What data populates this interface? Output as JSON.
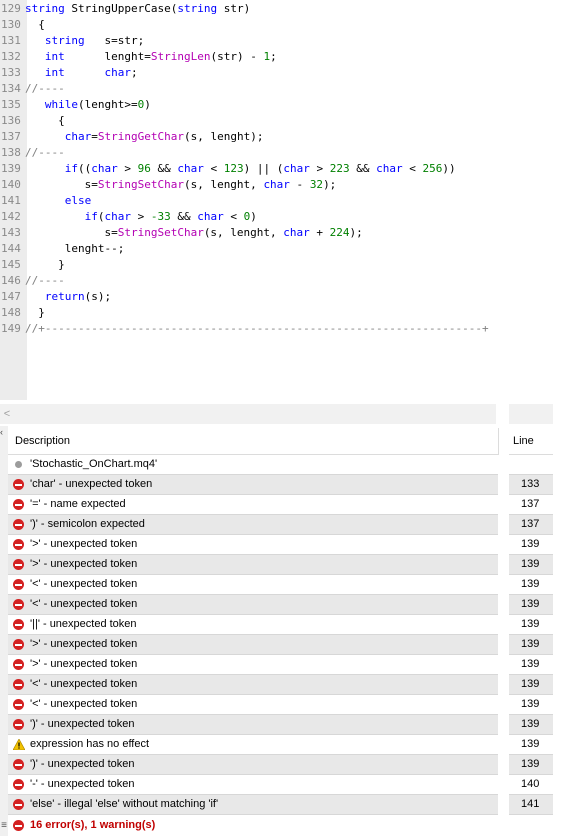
{
  "editor": {
    "lines": [
      {
        "no": "129",
        "html": "<span class=\"kw\">string</span> StringUpperCase(<span class=\"kw\">string</span> str)"
      },
      {
        "no": "130",
        "html": "  {"
      },
      {
        "no": "131",
        "html": "   <span class=\"kw\">string</span>   s=str;"
      },
      {
        "no": "132",
        "html": "   <span class=\"kw\">int</span>      lenght=<span class=\"fn\">StringLen</span>(str) - <span class=\"num\">1</span>;"
      },
      {
        "no": "133",
        "html": "   <span class=\"kw\">int</span>      <span class=\"kw\">char</span>;"
      },
      {
        "no": "134",
        "html": "<span class=\"cm\">//----</span>"
      },
      {
        "no": "135",
        "html": "   <span class=\"kw\">while</span>(lenght>=<span class=\"num\">0</span>)"
      },
      {
        "no": "136",
        "html": "     {"
      },
      {
        "no": "137",
        "html": "      <span class=\"kw\">char</span>=<span class=\"fn\">StringGetChar</span>(s, lenght);"
      },
      {
        "no": "138",
        "html": "<span class=\"cm\">//----</span>"
      },
      {
        "no": "139",
        "html": "      <span class=\"kw\">if</span>((<span class=\"kw\">char</span> > <span class=\"num\">96</span> && <span class=\"kw\">char</span> < <span class=\"num\">123</span>) || (<span class=\"kw\">char</span> > <span class=\"num\">223</span> && <span class=\"kw\">char</span> < <span class=\"num\">256</span>))"
      },
      {
        "no": "140",
        "html": "         s=<span class=\"fn\">StringSetChar</span>(s, lenght, <span class=\"kw\">char</span> - <span class=\"num\">32</span>);"
      },
      {
        "no": "141",
        "html": "      <span class=\"kw\">else</span>"
      },
      {
        "no": "142",
        "html": "         <span class=\"kw\">if</span>(<span class=\"kw\">char</span> > <span class=\"num\">-33</span> && <span class=\"kw\">char</span> < <span class=\"num\">0</span>)"
      },
      {
        "no": "143",
        "html": "            s=<span class=\"fn\">StringSetChar</span>(s, lenght, <span class=\"kw\">char</span> + <span class=\"num\">224</span>);"
      },
      {
        "no": "144",
        "html": "      lenght--;"
      },
      {
        "no": "145",
        "html": "     }"
      },
      {
        "no": "146",
        "html": "<span class=\"cm\">//----</span>"
      },
      {
        "no": "147",
        "html": "   <span class=\"kw\">return</span>(s);"
      },
      {
        "no": "148",
        "html": "  }"
      },
      {
        "no": "149",
        "html": "<span class=\"cm\">//+------------------------------------------------------------------+</span>"
      }
    ]
  },
  "scroll_left_glyph": "<",
  "panel": {
    "header_description": "Description",
    "header_line": "Line",
    "rows": [
      {
        "icon": "file",
        "text": "'Stochastic_OnChart.mq4'",
        "line": ""
      },
      {
        "icon": "error",
        "text": "'char' - unexpected token",
        "line": "133"
      },
      {
        "icon": "error",
        "text": "'=' - name expected",
        "line": "137"
      },
      {
        "icon": "error",
        "text": "')' - semicolon expected",
        "line": "137"
      },
      {
        "icon": "error",
        "text": "'>' - unexpected token",
        "line": "139"
      },
      {
        "icon": "error",
        "text": "'>' - unexpected token",
        "line": "139"
      },
      {
        "icon": "error",
        "text": "'<' - unexpected token",
        "line": "139"
      },
      {
        "icon": "error",
        "text": "'<' - unexpected token",
        "line": "139"
      },
      {
        "icon": "error",
        "text": "'||' - unexpected token",
        "line": "139"
      },
      {
        "icon": "error",
        "text": "'>' - unexpected token",
        "line": "139"
      },
      {
        "icon": "error",
        "text": "'>' - unexpected token",
        "line": "139"
      },
      {
        "icon": "error",
        "text": "'<' - unexpected token",
        "line": "139"
      },
      {
        "icon": "error",
        "text": "'<' - unexpected token",
        "line": "139"
      },
      {
        "icon": "error",
        "text": "')' - unexpected token",
        "line": "139"
      },
      {
        "icon": "warning",
        "text": "expression has no effect",
        "line": "139"
      },
      {
        "icon": "error",
        "text": "')' - unexpected token",
        "line": "139"
      },
      {
        "icon": "error",
        "text": "'-' - unexpected token",
        "line": "140"
      },
      {
        "icon": "error",
        "text": "'else' - illegal 'else' without matching 'if'",
        "line": "141"
      }
    ],
    "summary": "16 error(s), 1 warning(s)"
  },
  "colors": {
    "error": "#d42121",
    "warning": "#f2c200",
    "summary_text": "#c00000"
  }
}
